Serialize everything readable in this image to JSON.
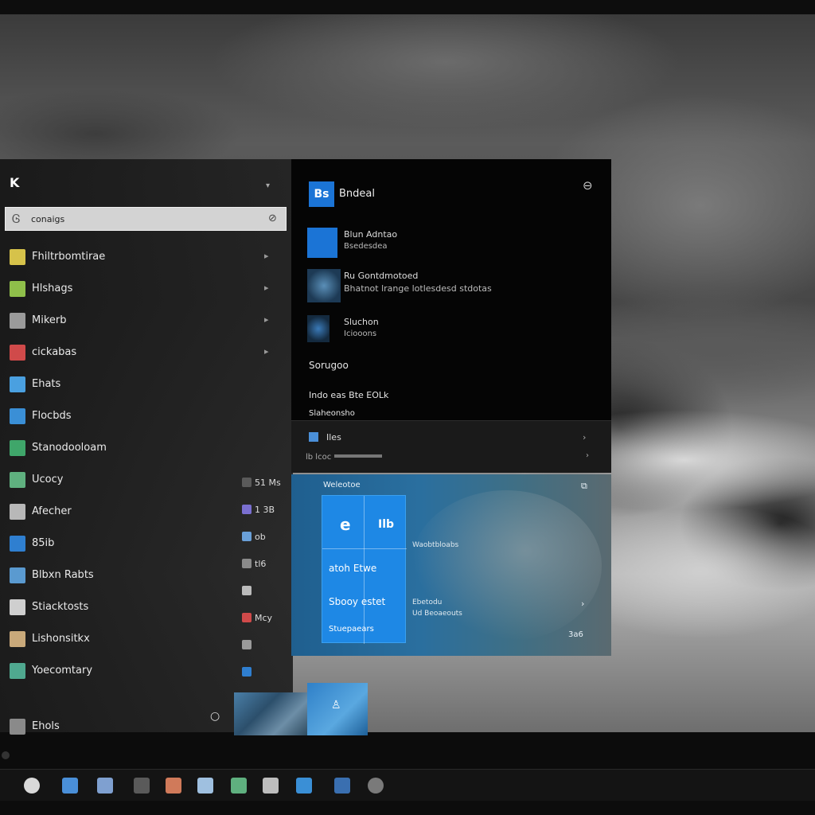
{
  "start_menu": {
    "top_glyph": "K",
    "search": {
      "value": "conaigs",
      "icon": "search-glyph"
    },
    "apps": [
      {
        "label": "Fhiltrbomtirae",
        "color": "#d6c24a"
      },
      {
        "label": "Hlshags",
        "color": "#8fbf4a"
      },
      {
        "label": "Mikerb",
        "color": "#9a9a9a"
      },
      {
        "label": "cickabas",
        "color": "#d04a4a"
      },
      {
        "label": "Ehats",
        "color": "#4aa0e0"
      },
      {
        "label": "Flocbds",
        "color": "#3a8fd6"
      },
      {
        "label": "Stanodooloam",
        "color": "#3fa66a"
      },
      {
        "label": "Ucocy",
        "color": "#5fb07f"
      },
      {
        "label": "Afecher",
        "color": "#b8b8b8"
      },
      {
        "label": "85ib",
        "color": "#2f7fd0"
      },
      {
        "label": "Blbxn Rabts",
        "color": "#5a9ad0"
      },
      {
        "label": "Stiacktosts",
        "color": "#cfcfcf"
      },
      {
        "label": "Lishonsitkx",
        "color": "#c9a97a"
      },
      {
        "label": "Yoecomtary",
        "color": "#4fa88f"
      }
    ],
    "bottom_item": "Ehols",
    "middle_strip": [
      {
        "label": "51 Ms",
        "color": "#5a5a5a"
      },
      {
        "label": "1 3B",
        "color": "#7a6fd0"
      },
      {
        "label": "ob",
        "color": "#6aa0d8"
      },
      {
        "label": "tl6",
        "color": "#8a8a8a"
      },
      {
        "label": "",
        "color": "#bbbbbb"
      },
      {
        "label": "Mcy",
        "color": "#d04a4a"
      },
      {
        "label": "",
        "color": "#9a9a9a"
      },
      {
        "label": "",
        "color": "#2f7fd0"
      }
    ]
  },
  "panel": {
    "header_icon": "Bs",
    "header_title": "Bndeal",
    "row1": {
      "title": "Blun Adntao",
      "subtitle": "Bsedesdea"
    },
    "row2": {
      "title": "Ru Gontdmotoed",
      "subtitle": "Bhatnot lrange lotlesdesd stdotas"
    },
    "row3": {
      "title": "Sluchon",
      "subtitle": "Iciooons"
    },
    "text1": "Sorugoo",
    "text2": "Indo eas Bte EOLk",
    "text3": "Slaheonsho",
    "strip_row1": "Iles",
    "strip_row2": "lb lcoc",
    "colors": {
      "accent": "#1b74d6",
      "tile": "#1e88e5"
    }
  },
  "tiles": {
    "group_title": "Weleotoe",
    "main_e": "e",
    "main_top": "Ilb",
    "main_mid": "atoh Etwe",
    "main_low": "Sbooy estet",
    "main_bot": "Stuepaears",
    "side1": "Waobtbloabs",
    "side2": "Ebetodu",
    "side3": "Ud Beoaeouts",
    "corner": "3a6"
  },
  "taskbar": {
    "icons": [
      {
        "name": "chrome-icon",
        "color": "#d9d9d9"
      },
      {
        "name": "laptop-icon",
        "color": "#4a8fd8"
      },
      {
        "name": "store-icon",
        "color": "#7fa0d0"
      },
      {
        "name": "pen-icon",
        "color": "#5a5a5a"
      },
      {
        "name": "photo-icon",
        "color": "#d07a5a"
      },
      {
        "name": "brush-icon",
        "color": "#9fc0e0"
      },
      {
        "name": "chat-icon",
        "color": "#5fb07f"
      },
      {
        "name": "music-icon",
        "color": "#bdbdbd"
      },
      {
        "name": "device-icon",
        "color": "#3a8fd6"
      },
      {
        "name": "globe-icon",
        "color": "#3a6fb0"
      },
      {
        "name": "circle-icon",
        "color": "#7a7a7a"
      }
    ]
  }
}
